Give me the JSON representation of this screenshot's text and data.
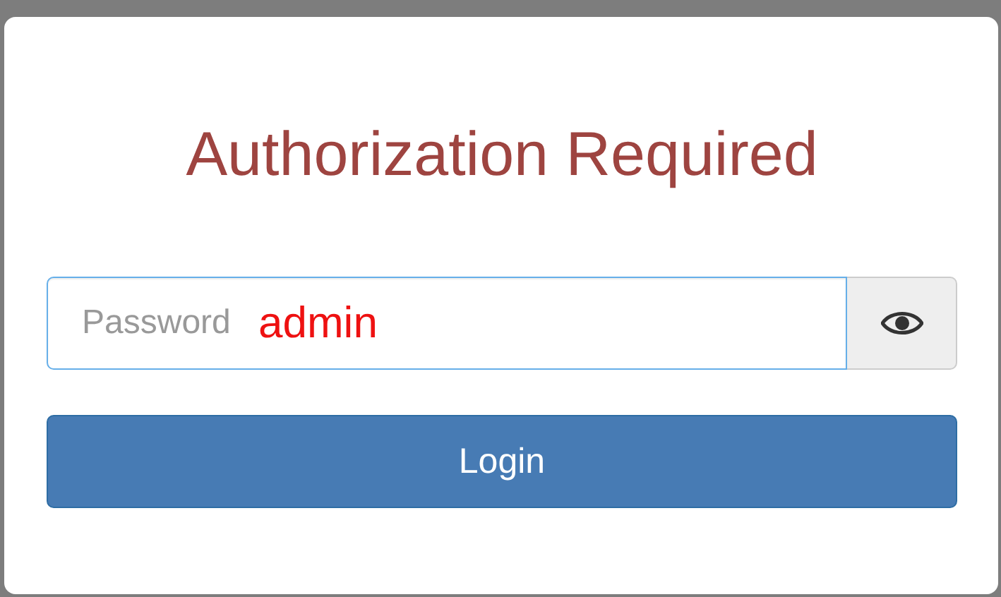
{
  "dialog": {
    "title": "Authorization Required"
  },
  "password": {
    "placeholder": "Password",
    "overlay_text": "admin"
  },
  "login_button": {
    "label": "Login"
  }
}
